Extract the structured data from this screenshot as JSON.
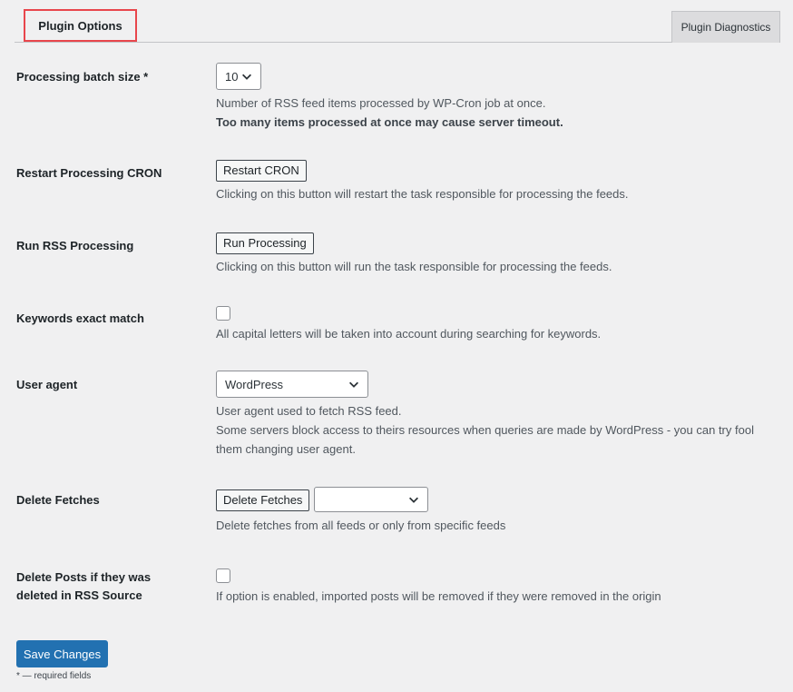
{
  "tabs": {
    "active": "Plugin Options",
    "secondary": "Plugin Diagnostics"
  },
  "batch": {
    "label": "Processing batch size *",
    "value": "10",
    "desc1": "Number of RSS feed items processed by WP-Cron job at once.",
    "desc2": "Too many items processed at once may cause server timeout."
  },
  "restart": {
    "label": "Restart Processing CRON",
    "button": "Restart CRON",
    "desc": "Clicking on this button will restart the task responsible for processing the feeds."
  },
  "run": {
    "label": "Run RSS Processing",
    "button": "Run Processing",
    "desc": "Clicking on this button will run the task responsible for processing the feeds."
  },
  "keywords": {
    "label": "Keywords exact match",
    "checked": false,
    "desc": "All capital letters will be taken into account during searching for keywords."
  },
  "useragent": {
    "label": "User agent",
    "value": "WordPress",
    "desc1": "User agent used to fetch RSS feed.",
    "desc2": "Some servers block access to theirs resources when queries are made by WordPress - you can try fool them changing user agent."
  },
  "fetches": {
    "label": "Delete Fetches",
    "button": "Delete Fetches",
    "select_value": "",
    "desc": "Delete fetches from all feeds or only from specific feeds"
  },
  "deleteposts": {
    "label": "Delete Posts if they was deleted in RSS Source",
    "checked": false,
    "desc": "If option is enabled, imported posts will be removed if they were removed in the origin"
  },
  "footer": {
    "save": "Save Changes",
    "required_note": "* — required fields"
  },
  "icons": {
    "chevron": "chevron-down-icon"
  }
}
